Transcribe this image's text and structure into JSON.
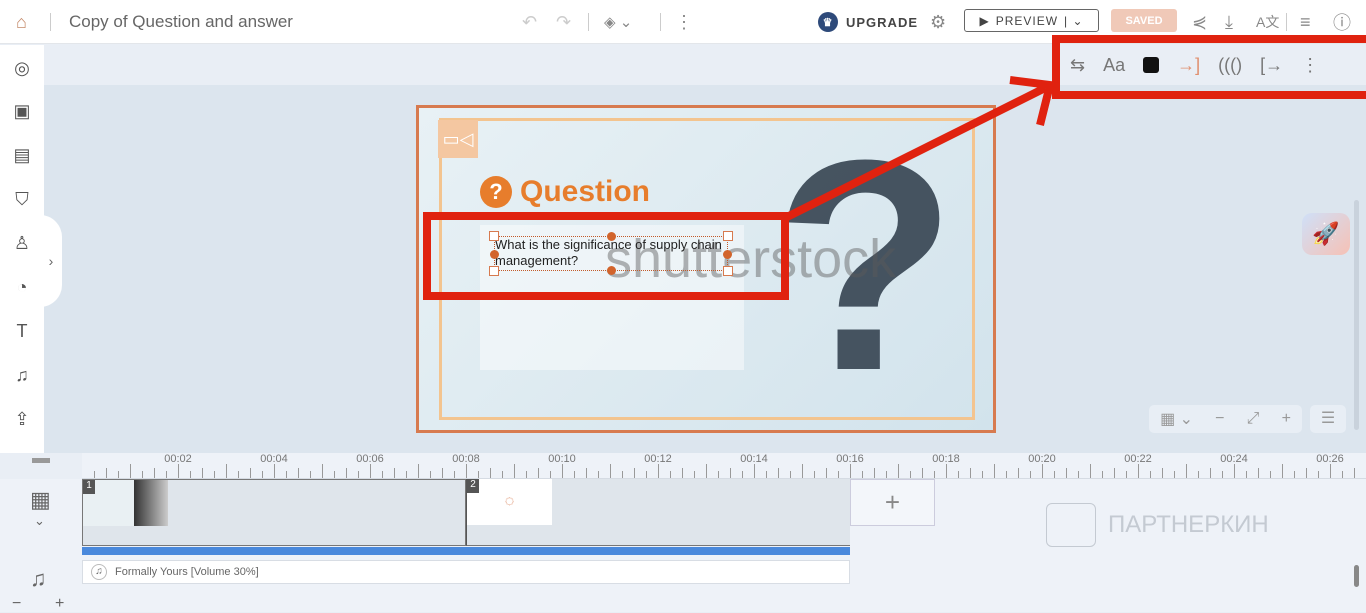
{
  "header": {
    "title": "Copy of Question and answer",
    "upgrade": "UPGRADE",
    "preview": "PREVIEW",
    "saved": "SAVED"
  },
  "toolbar": {
    "font_label": "Aa",
    "text_color": "#111111"
  },
  "slide": {
    "heading": "Question",
    "question_text": "What is the significance of supply chain management?",
    "watermark": "shutterstock"
  },
  "timeline": {
    "ticks": [
      "00:02",
      "00:04",
      "00:06",
      "00:08",
      "00:10",
      "00:12",
      "00:14",
      "00:16",
      "00:18",
      "00:20",
      "00:22",
      "00:24",
      "00:26"
    ],
    "scenes": [
      {
        "number": "1",
        "start": 0,
        "end": 8
      },
      {
        "number": "2",
        "start": 8,
        "end": 16
      }
    ],
    "audio_track": "Formally Yours [Volume 30%]"
  },
  "watermark_overlay": "ПАРТНЕРКИН",
  "colors": {
    "accent": "#e77d2c",
    "annotation": "#e0220f",
    "track": "#4a89dc"
  }
}
